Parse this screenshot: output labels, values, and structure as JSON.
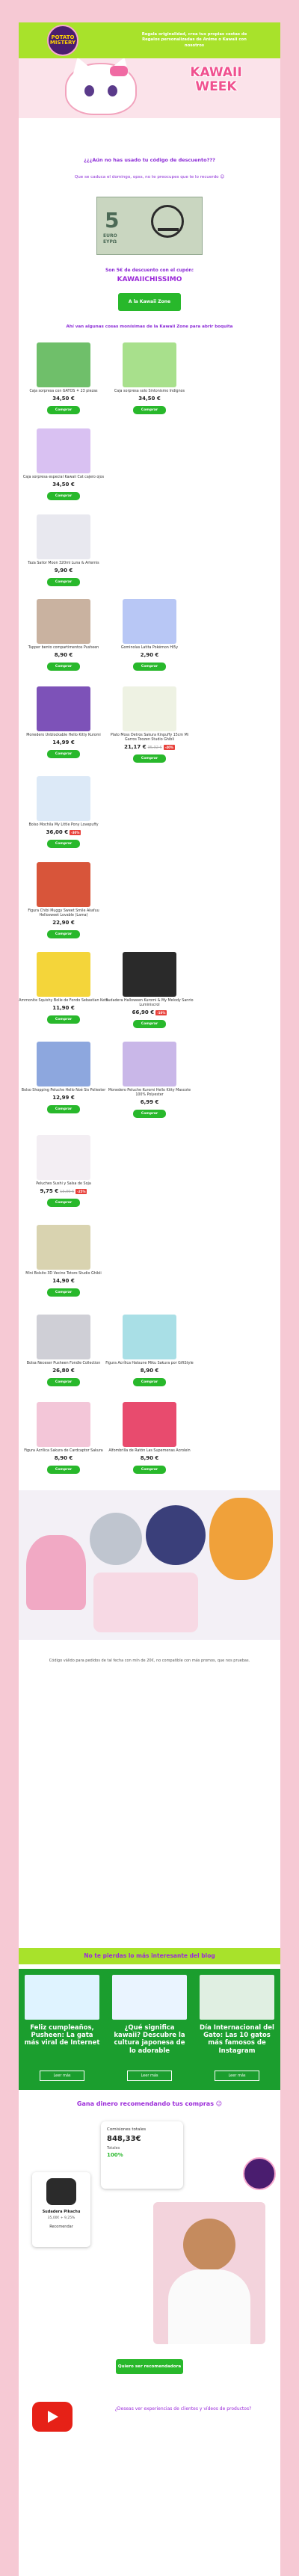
{
  "brand": {
    "logo_text": "POTATO MISTERY"
  },
  "header": {
    "text": "Regala originalidad, crea tus propias cestas de Regalos personalizadas de Anime o Kawaii con nosotros"
  },
  "banner": {
    "title_line1": "KAWAII",
    "title_line2": "WEEK"
  },
  "intro": {
    "heading": "¿¿¿Aún no has usado tu código de descuento???",
    "subheading": "Que se caduca el domingo, opss, no te preocupes que te lo recuerdo 😉",
    "bill_number": "5",
    "bill_label": "EURO",
    "bill_label2": "EYPΩ",
    "offer": "Son 5€ de descuento con el cupón:",
    "coupon": "KAWAIICHISSIMO",
    "cta": "A la Kawaii Zone",
    "products_intro": "Ahí van algunas cosas monísimas de la Kawaii Zone para abrir boquita"
  },
  "buy_label": "Comprar",
  "products": [
    {
      "name": "Caja sorpresa con GATOS ⚘ 23 piezas",
      "price": "34,50 €",
      "old": "",
      "disc": ""
    },
    {
      "name": "Caja sorpresa solo Sintonismo Indignos",
      "price": "34,50 €",
      "old": "",
      "disc": ""
    },
    {
      "name": "Caja sorpresa especial Kawaii Cat cajero ojos",
      "price": "34,50 €",
      "old": "",
      "disc": ""
    },
    {
      "name": "",
      "price": "",
      "old": "",
      "disc": ""
    },
    {
      "name": "Taza Sailor Moon 320ml Luna & Artemis",
      "price": "9,90 €",
      "old": "",
      "disc": ""
    },
    {
      "name": "",
      "price": "",
      "old": "",
      "disc": ""
    },
    {
      "name": "Tupper bento compartimentos Pusheen",
      "price": "8,90 €",
      "old": "",
      "disc": ""
    },
    {
      "name": "Gominolas Latita Pokémon Hi5y",
      "price": "2,90 €",
      "old": "",
      "disc": ""
    },
    {
      "name": "Monedero Unblockable Hello Kitty Kuromi",
      "price": "14,99 €",
      "old": "",
      "disc": ""
    },
    {
      "name": "Plato Moss Detros Sakura Kinpuffy 15cm Mi Garros Toozen Studio Ghibli",
      "price": "21,17 €",
      "old": "35,32 €",
      "disc": "-40%"
    },
    {
      "name": "Bolso Mochila My Little Pony Lovepuffy",
      "price": "36,00 €",
      "old": "",
      "disc": "-30%"
    },
    {
      "name": "",
      "price": "",
      "old": "",
      "disc": ""
    },
    {
      "name": "Figura Chibi Muggy Sweet Smile Akafuu Hellosweet Lovable (Lama)",
      "price": "22,90 €",
      "old": "",
      "disc": ""
    },
    {
      "name": "",
      "price": "",
      "old": "",
      "disc": ""
    },
    {
      "name": "Ammonite Squishy Bolle de Fondo Sebastian Keto",
      "price": "11,90 €",
      "old": "",
      "disc": ""
    },
    {
      "name": "Sudadera Halloween Kuromi & My Melody Sanrio Luminiscrol",
      "price": "66,90 €",
      "old": "",
      "disc": "-10%"
    },
    {
      "name": "Bolso Shopping Peluche Hello Noé Sis Poliester",
      "price": "12,99 €",
      "old": "",
      "disc": ""
    },
    {
      "name": "Monedero Peluche Kuromi Hello Kitty Mascote 100% Polyester",
      "price": "6,99 €",
      "old": "",
      "disc": ""
    },
    {
      "name": "Peluches Sushi y Salsa de Soja",
      "price": "9,75 €",
      "old": "13,00 €",
      "disc": "-25%"
    },
    {
      "name": "",
      "price": "",
      "old": "",
      "disc": ""
    },
    {
      "name": "Mini Bolsito 3D Vecino Totoro Studio Ghibli",
      "price": "14,90 €",
      "old": "",
      "disc": ""
    },
    {
      "name": "",
      "price": "",
      "old": "",
      "disc": ""
    },
    {
      "name": "Bolsa Neceser Pusheen Fondle Collection",
      "price": "26,80 €",
      "old": "",
      "disc": ""
    },
    {
      "name": "Figura Acrílica Hatsune Miku Sakura por GiftStyle",
      "price": "8,90 €",
      "old": "",
      "disc": ""
    },
    {
      "name": "Figura Acrílica Sakura de Cardcaptor Sakura",
      "price": "8,90 €",
      "old": "",
      "disc": ""
    },
    {
      "name": "Alfombrilla de Ratón Las Supernenas Acrolein",
      "price": "8,90 €",
      "old": "",
      "disc": ""
    }
  ],
  "footer_note": "Código válido para pedidos de tal fecha con mín de 20€, no compatible con más promos, que nos pruebas.",
  "blog": {
    "heading": "No te pierdas lo  más interesante del blog",
    "cards": [
      {
        "title": "Feliz cumpleaños, Pusheen: La gata más viral de Internet",
        "button": "Leer más"
      },
      {
        "title": "¿Qué significa kawaii? Descubre la cultura japonesa de lo adorable",
        "button": "Leer más"
      },
      {
        "title": "Día Internacional del Gato: Las 10 gatos más famosos de Instagram",
        "button": "Leer más"
      }
    ]
  },
  "affiliate": {
    "heading": "Gana dinero recomendando tus compras 😉",
    "commissions_label": "Comisiones totales",
    "commissions_value": "848,33€",
    "totals_label": "Totales",
    "percent": "100%",
    "item_name": "Sudadera Pikachu",
    "item_price": "35,00€ + 9,25%",
    "recommend": "Recomendar",
    "cta": "Quiero ser recomendadora",
    "question": "¿Deseas ver experiencias de clientes y vídeos de productos?"
  }
}
